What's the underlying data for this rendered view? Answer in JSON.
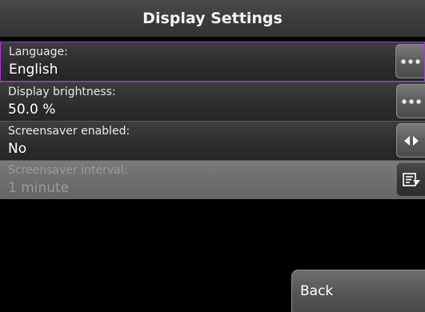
{
  "header": {
    "title": "Display Settings"
  },
  "settings": [
    {
      "label": "Language:",
      "value": "English",
      "button_icon": "more-dots-icon",
      "selected": true,
      "disabled": false
    },
    {
      "label": "Display brightness:",
      "value": "50.0 %",
      "button_icon": "more-dots-icon",
      "selected": false,
      "disabled": false
    },
    {
      "label": "Screensaver enabled:",
      "value": "No",
      "button_icon": "left-right-arrows-icon",
      "selected": false,
      "disabled": false
    },
    {
      "label": "Screensaver interval:",
      "value": "1 minute",
      "button_icon": "list-dropdown-icon",
      "selected": false,
      "disabled": true
    }
  ],
  "footer": {
    "back_label": "Back"
  },
  "colors": {
    "selection_border": "#a13ad6",
    "background": "#000000"
  }
}
